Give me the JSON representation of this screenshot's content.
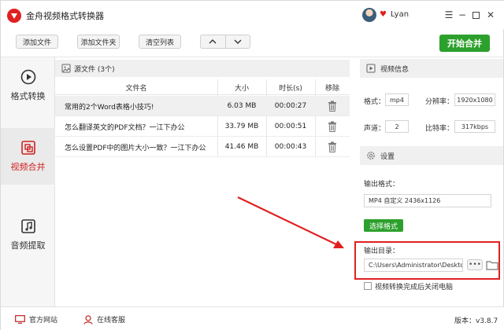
{
  "window": {
    "title": "金舟视频格式转换器",
    "user_name": "Lyan",
    "controls": [
      "menu-icon",
      "minimize-icon",
      "maximize-icon",
      "close-icon"
    ]
  },
  "toolbar": {
    "add_file": "添加文件",
    "add_folder": "添加文件夹",
    "clear_list": "清空列表",
    "start_merge": "开始合并"
  },
  "sidebar": {
    "items": [
      {
        "label": "格式转换",
        "icon": "play-circle-icon"
      },
      {
        "label": "视频合并",
        "icon": "merge-icon",
        "active": true
      },
      {
        "label": "音频提取",
        "icon": "music-note-icon"
      }
    ]
  },
  "file_list": {
    "title": "源文件 (3个)",
    "columns": [
      "文件名",
      "大小",
      "时长(s)",
      "移除"
    ],
    "rows": [
      {
        "name": "常用的2个Word表格小技巧!",
        "size": "6.03 MB",
        "duration": "00:00:27"
      },
      {
        "name": "怎么翻译英文的PDF文档？一江下办公",
        "size": "33.79 MB",
        "duration": "00:00:51"
      },
      {
        "name": "怎么设置PDF中的图片大小一致？一江下办公",
        "size": "41.46 MB",
        "duration": "00:00:43"
      }
    ]
  },
  "video_info": {
    "title": "视频信息",
    "format_label": "格式：",
    "format_value": "mp4",
    "resolution_label": "分辨率：",
    "resolution_value": "1920x1080",
    "channels_label": "声道：",
    "channels_value": "2",
    "bitrate_label": "比特率：",
    "bitrate_value": "317kbps"
  },
  "settings": {
    "title": "设置",
    "output_format_label": "输出格式：",
    "output_format_value": "MP4 自定义 2436x1126",
    "choose_format": "选择格式",
    "output_dir_label": "输出目录：",
    "output_dir_value": "C:\\Users\\Administrator\\Deskto",
    "more_label": "•••",
    "shutdown_label": "视频转换完成后关闭电脑"
  },
  "footer": {
    "website": "官方网站",
    "support": "在线客服",
    "version": "版本：v3.8.7"
  },
  "colors": {
    "brand_red": "#e02020",
    "accent_green": "#2ca02c"
  }
}
